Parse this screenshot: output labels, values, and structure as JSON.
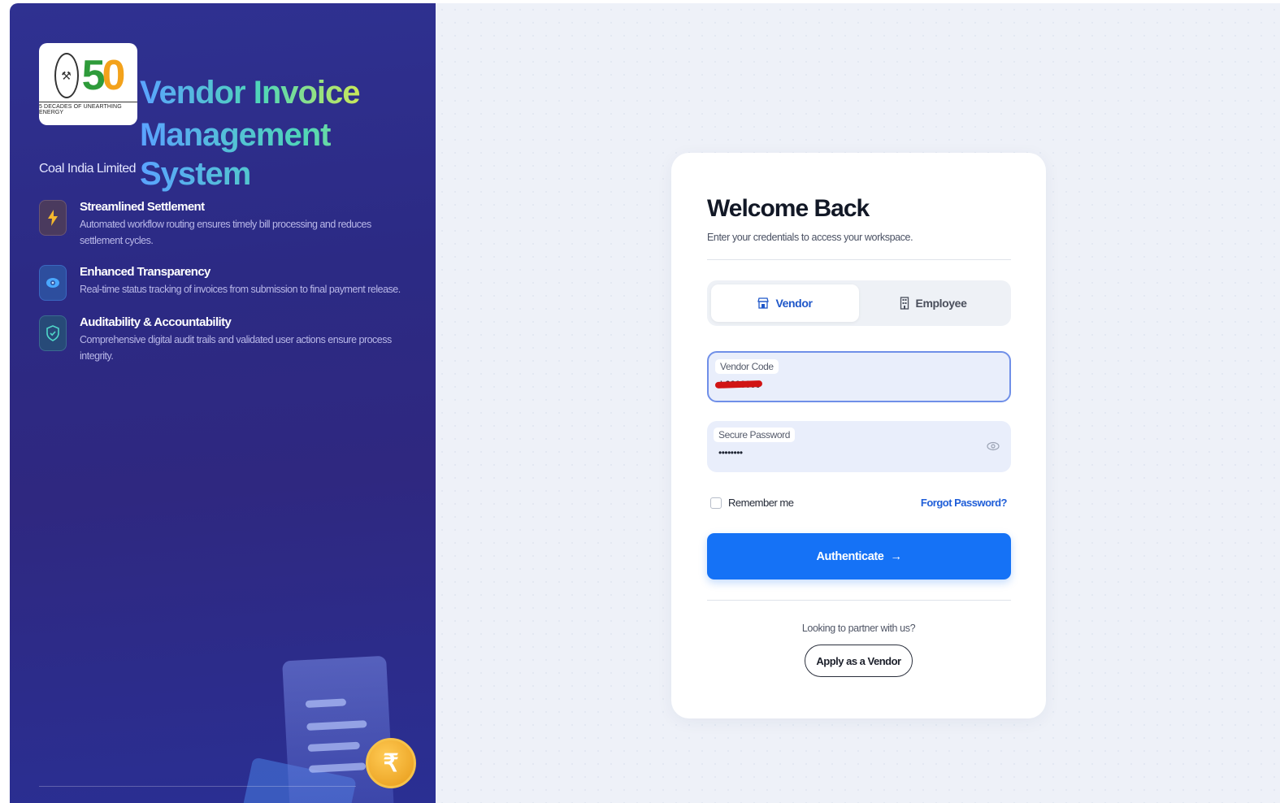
{
  "brand": {
    "logo_caption": "5 DECADES OF UNEARTHING ENERGY",
    "logo_number": "50",
    "title_line1": "Vendor Invoice",
    "title_line2": "Management System",
    "organization": "Coal India Limited"
  },
  "features": [
    {
      "title": "Streamlined Settlement",
      "description": "Automated workflow routing ensures timely bill processing and reduces settlement cycles.",
      "icon": "lightning-icon"
    },
    {
      "title": "Enhanced Transparency",
      "description": "Real-time status tracking of invoices from submission to final payment release.",
      "icon": "eye-icon"
    },
    {
      "title": "Auditability & Accountability",
      "description": "Comprehensive digital audit trails and validated user actions ensure process integrity.",
      "icon": "shield-check-icon"
    }
  ],
  "illustration": {
    "currency_symbol": "₹"
  },
  "login": {
    "heading": "Welcome Back",
    "subtitle": "Enter your credentials to access your workspace.",
    "tabs": [
      {
        "label": "Vendor",
        "icon": "store-icon",
        "active": true
      },
      {
        "label": "Employee",
        "icon": "building-icon",
        "active": false
      }
    ],
    "vendor_code_label": "Vendor Code",
    "vendor_code_value": "b0000000",
    "password_label": "Secure Password",
    "password_value": "••••••••",
    "remember_label": "Remember me",
    "forgot_label": "Forgot Password?",
    "submit_label": "Authenticate",
    "submit_arrow": "→",
    "partner_text": "Looking to partner with us?",
    "apply_label": "Apply as a Vendor"
  },
  "colors": {
    "panel_bg": "#2c2a84",
    "accent_blue": "#1572f6",
    "link_blue": "#1f5ed8",
    "coin_gold": "#f3a21b"
  }
}
